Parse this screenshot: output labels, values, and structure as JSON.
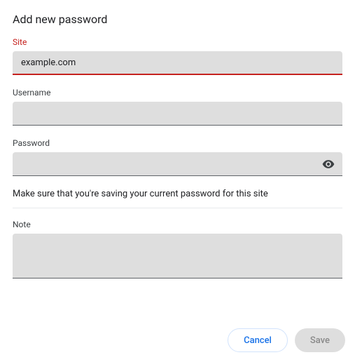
{
  "title": "Add new password",
  "fields": {
    "site": {
      "label": "Site",
      "value": "example.com"
    },
    "username": {
      "label": "Username",
      "value": ""
    },
    "password": {
      "label": "Password",
      "value": ""
    },
    "note": {
      "label": "Note",
      "value": ""
    }
  },
  "helper_text": "Make sure that you're saving your current password for this site",
  "icons": {
    "eye": "eye-icon"
  },
  "buttons": {
    "cancel": "Cancel",
    "save": "Save"
  },
  "colors": {
    "error": "#c5221f",
    "primary": "#1a73e8",
    "field_bg": "#dedede"
  }
}
